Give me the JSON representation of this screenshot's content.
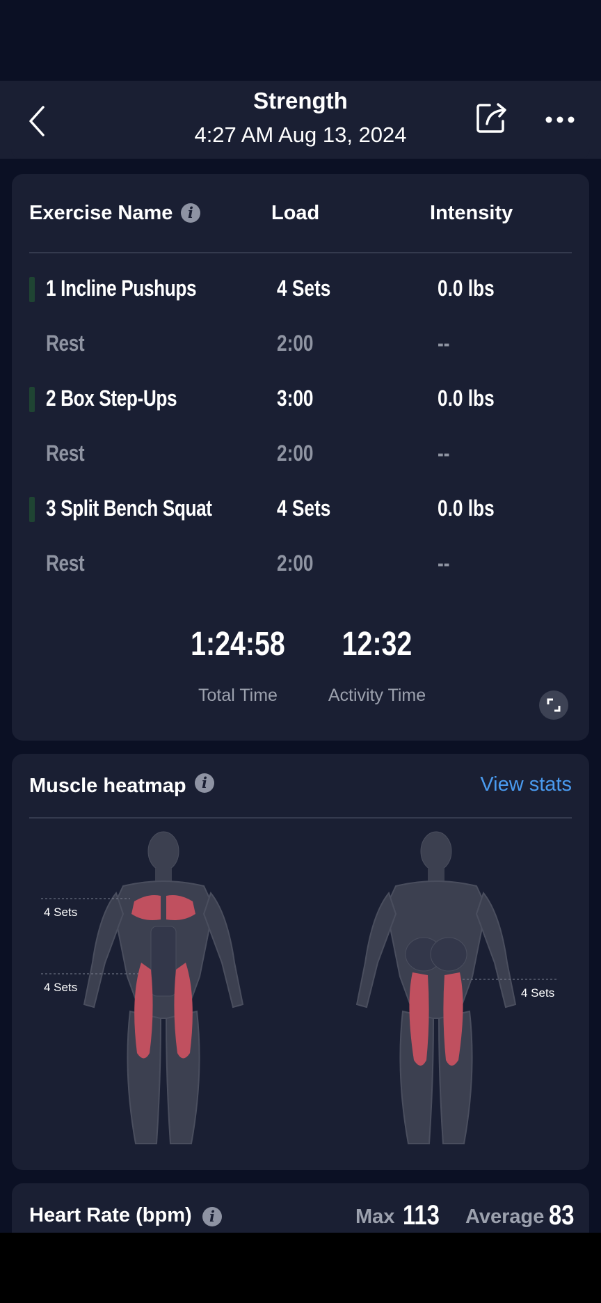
{
  "header": {
    "title": "Strength",
    "datetime": "4:27 AM Aug 13, 2024"
  },
  "exercise_table": {
    "col_name": "Exercise Name",
    "col_load": "Load",
    "col_intensity": "Intensity",
    "rows": [
      {
        "name": "1 Incline Pushups",
        "load": "4 Sets",
        "intensity": "0.0 lbs"
      },
      {
        "name": "Rest",
        "load": "2:00",
        "intensity": "--"
      },
      {
        "name": "2 Box Step-Ups",
        "load": "3:00",
        "intensity": "0.0 lbs"
      },
      {
        "name": "Rest",
        "load": "2:00",
        "intensity": "--"
      },
      {
        "name": "3 Split Bench Squat",
        "load": "4 Sets",
        "intensity": "0.0 lbs"
      },
      {
        "name": "Rest",
        "load": "2:00",
        "intensity": "--"
      }
    ],
    "total_time": "1:24:58",
    "total_time_label": "Total Time",
    "activity_time": "12:32",
    "activity_time_label": "Activity Time"
  },
  "heatmap": {
    "title": "Muscle heatmap",
    "view_stats": "View stats",
    "front_chest_sets": "4 Sets",
    "front_quads_sets": "4 Sets",
    "back_hamstrings_sets": "4 Sets",
    "highlight_color": "#c0505f"
  },
  "heart_rate": {
    "title": "Heart Rate (bpm)",
    "max_label": "Max",
    "max_value": "113",
    "avg_label": "Average",
    "avg_value": "83"
  }
}
